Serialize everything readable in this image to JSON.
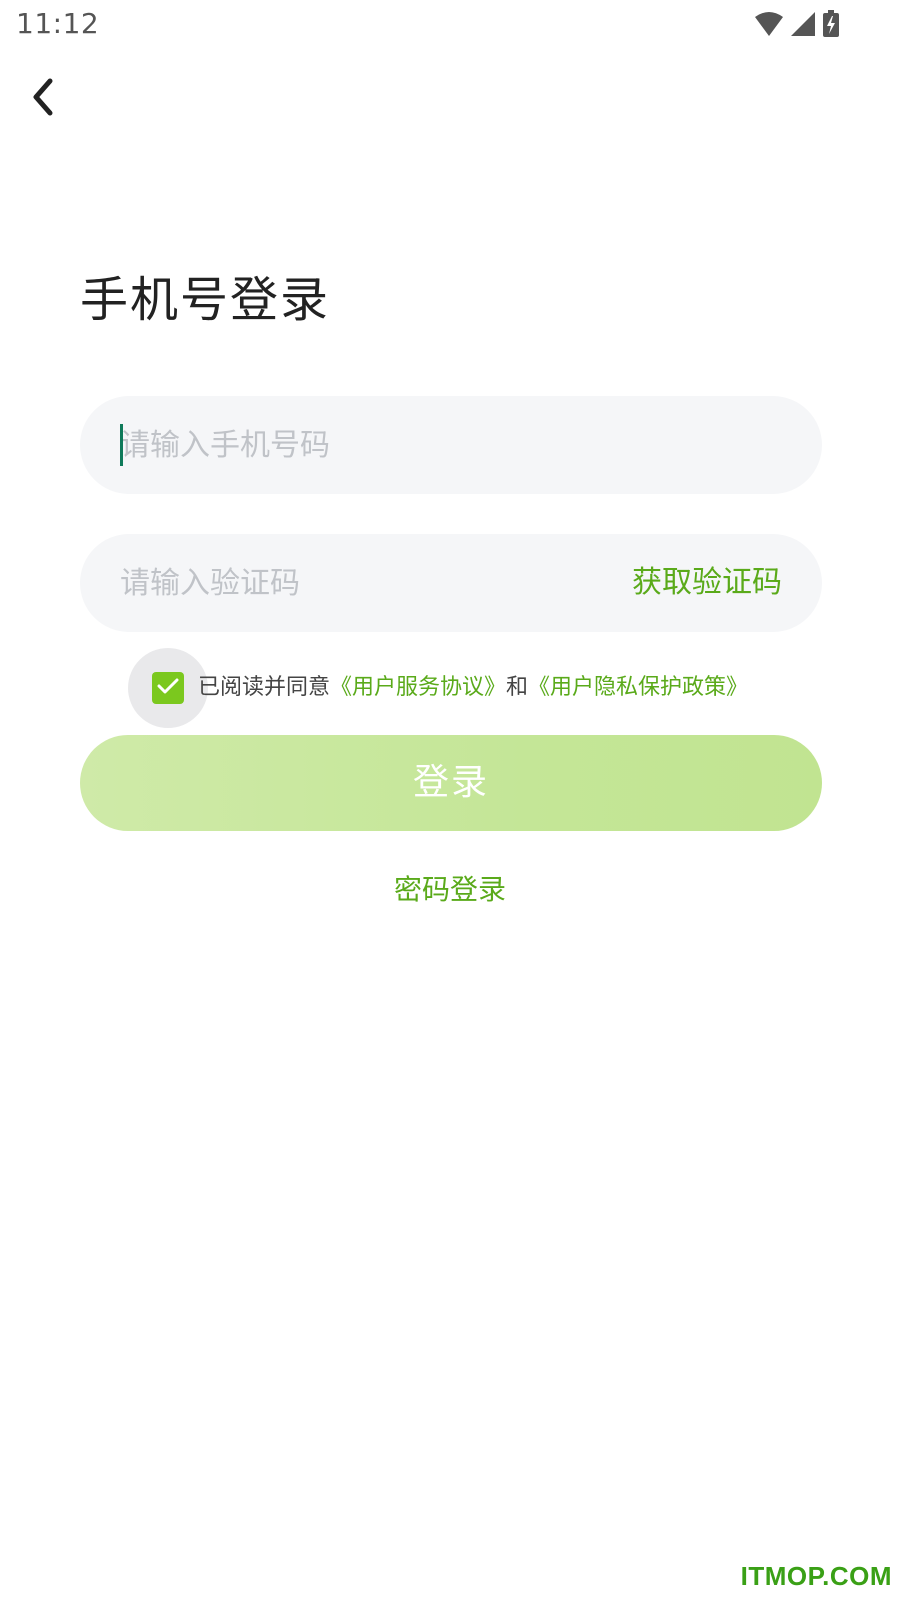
{
  "status_bar": {
    "time": "11:12",
    "icons": [
      "wifi-icon",
      "cellular-signal-icon",
      "battery-charging-icon"
    ]
  },
  "nav": {
    "back_icon": "chevron-left-icon"
  },
  "title": "手机号登录",
  "phone_input": {
    "placeholder": "请输入手机号码",
    "value": ""
  },
  "code_input": {
    "placeholder": "请输入验证码",
    "value": "",
    "get_code_label": "获取验证码"
  },
  "agreement": {
    "checked": true,
    "prefix": "已阅读并同意",
    "link1": "《用户服务协议》",
    "conjunction": "和",
    "link2": "《用户隐私保护政策》"
  },
  "login_button": {
    "label": "登录"
  },
  "password_login": {
    "label": "密码登录"
  },
  "watermark": "ITMOP.COM",
  "colors": {
    "accent": "#5aaa1a",
    "checkbox": "#7bc81e",
    "login_button": "#c4e697",
    "input_bg": "#f5f6f8"
  }
}
